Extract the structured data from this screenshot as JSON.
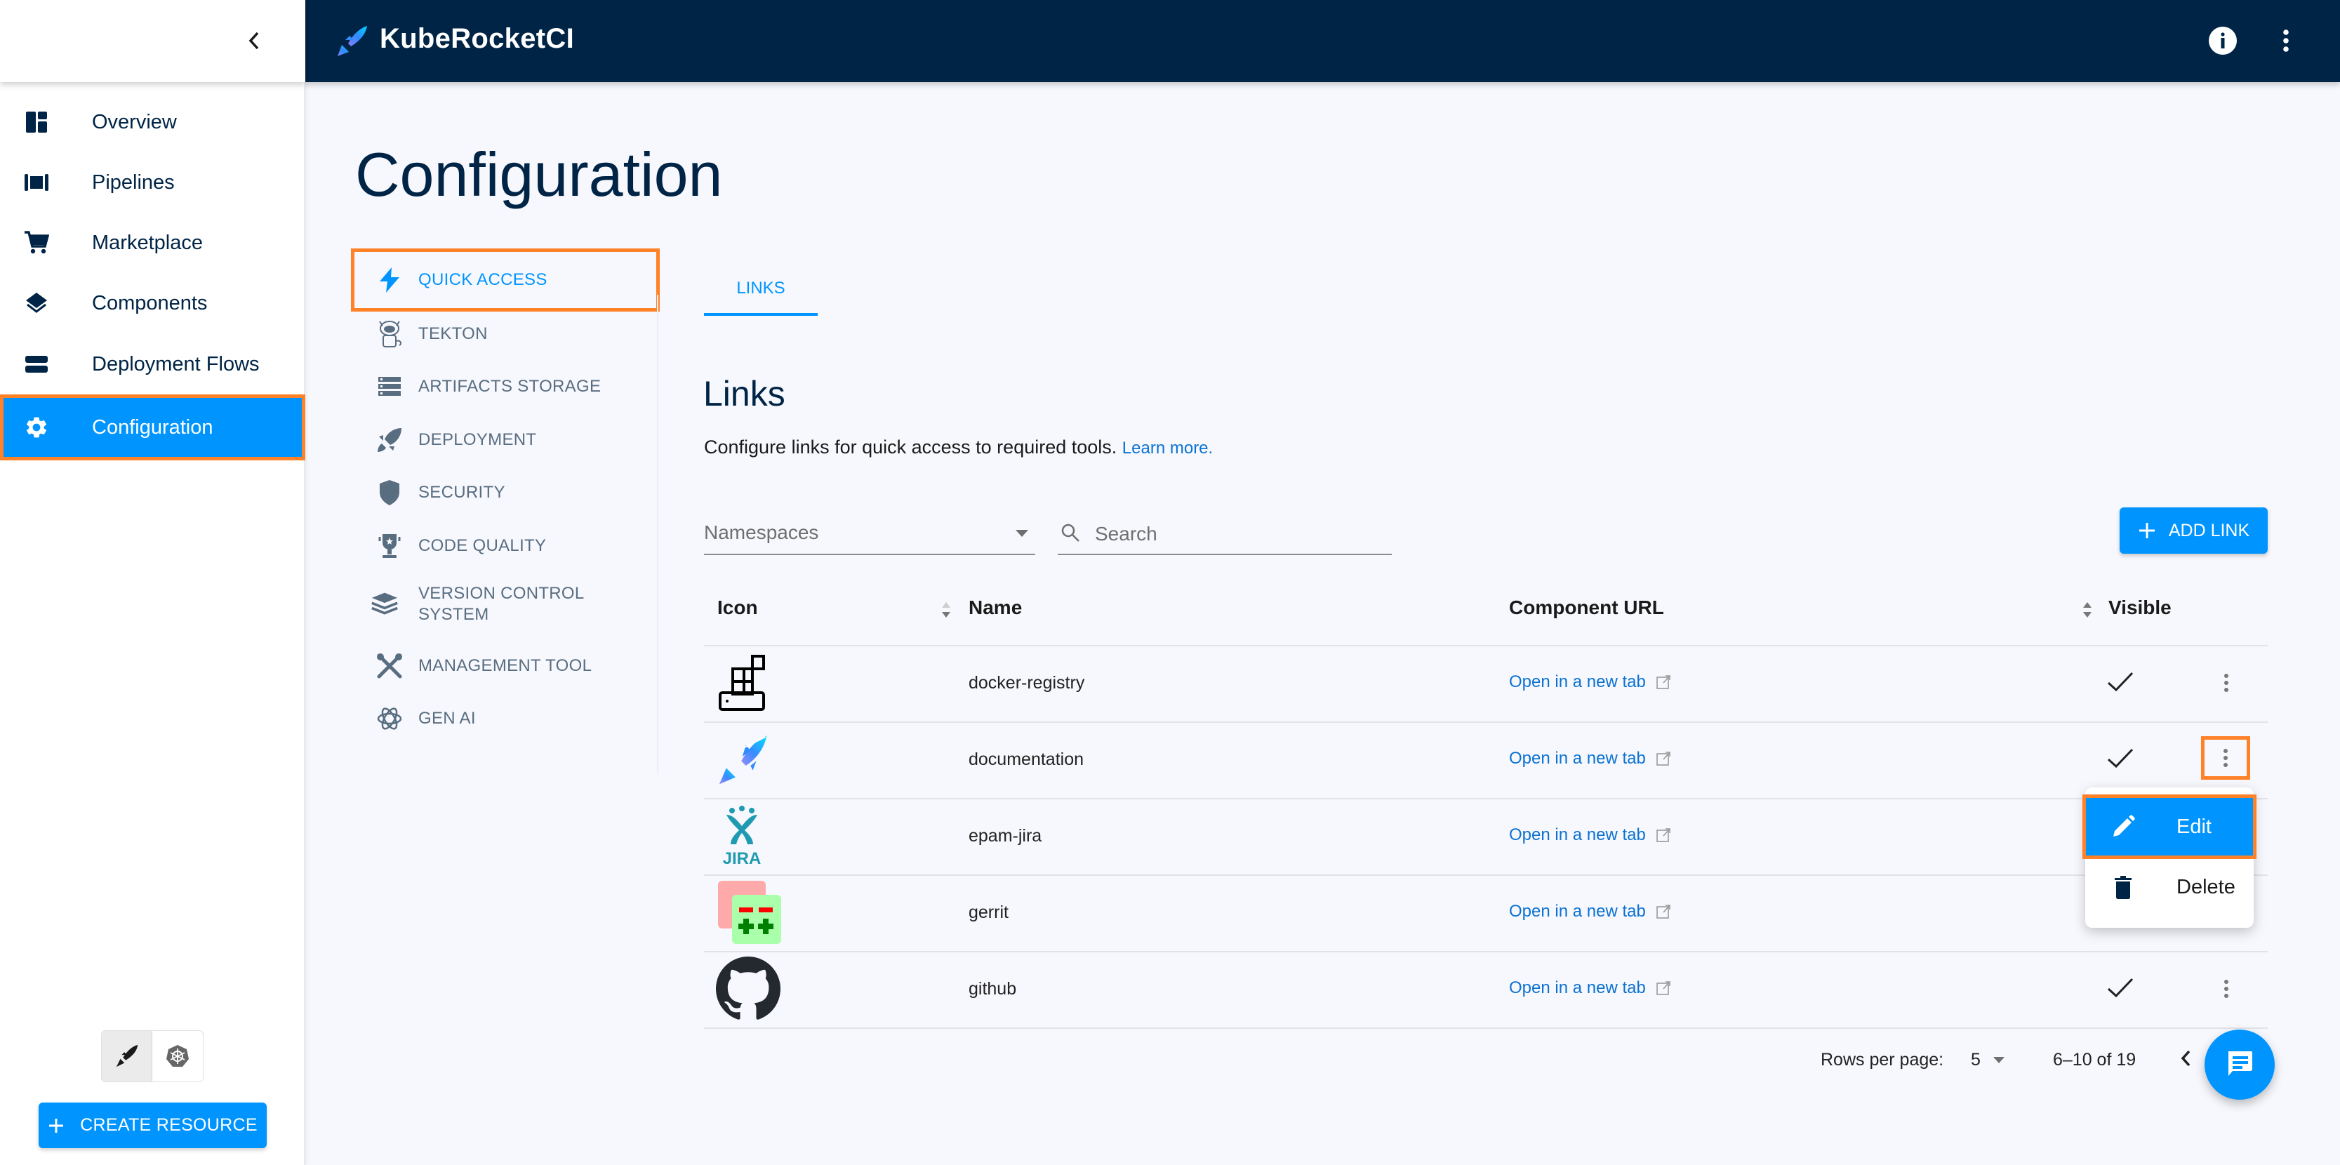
{
  "app": {
    "title": "KubeRocketCI",
    "brand_color": "#002446",
    "accent_color": "#0094ff",
    "highlight_color": "#ff8128"
  },
  "sidebar": {
    "items": [
      {
        "label": "Overview",
        "icon": "dashboard-icon"
      },
      {
        "label": "Pipelines",
        "icon": "pipelines-icon"
      },
      {
        "label": "Marketplace",
        "icon": "cart-icon"
      },
      {
        "label": "Components",
        "icon": "layers-icon"
      },
      {
        "label": "Deployment Flows",
        "icon": "flows-icon"
      },
      {
        "label": "Configuration",
        "icon": "gear-icon",
        "active": true
      }
    ],
    "mode_toggle": [
      "krci-mode",
      "kubernetes-mode"
    ],
    "create_button": "CREATE RESOURCE"
  },
  "page": {
    "title": "Configuration"
  },
  "subnav": {
    "items": [
      {
        "label": "QUICK ACCESS",
        "icon": "bolt-icon",
        "active": true
      },
      {
        "label": "TEKTON",
        "icon": "tekton-icon"
      },
      {
        "label": "ARTIFACTS STORAGE",
        "icon": "storage-icon"
      },
      {
        "label": "DEPLOYMENT",
        "icon": "rocket-icon"
      },
      {
        "label": "SECURITY",
        "icon": "shield-icon"
      },
      {
        "label": "CODE QUALITY",
        "icon": "trophy-icon"
      },
      {
        "label": "VERSION CONTROL SYSTEM",
        "icon": "stack-icon"
      },
      {
        "label": "MANAGEMENT TOOL",
        "icon": "tools-icon"
      },
      {
        "label": "GEN AI",
        "icon": "genai-icon"
      }
    ]
  },
  "tabs": [
    {
      "label": "LINKS",
      "active": true
    }
  ],
  "links": {
    "heading": "Links",
    "description": "Configure links for quick access to required tools.",
    "learn_more": "Learn more.",
    "namespaces_label": "Namespaces",
    "search_placeholder": "Search",
    "add_button": "ADD LINK"
  },
  "table": {
    "columns": [
      "Icon",
      "Name",
      "Component URL",
      "Visible"
    ],
    "rows": [
      {
        "icon": "docker-registry-icon",
        "name": "docker-registry",
        "url_label": "Open in a new tab",
        "visible": true
      },
      {
        "icon": "krci-logo-icon",
        "name": "documentation",
        "url_label": "Open in a new tab",
        "visible": true
      },
      {
        "icon": "jira-icon",
        "name": "epam-jira",
        "url_label": "Open in a new tab",
        "visible": true
      },
      {
        "icon": "gerrit-icon",
        "name": "gerrit",
        "url_label": "Open in a new tab",
        "visible": true
      },
      {
        "icon": "github-icon",
        "name": "github",
        "url_label": "Open in a new tab",
        "visible": true
      }
    ]
  },
  "row_menu": {
    "items": [
      {
        "label": "Edit",
        "icon": "pencil-icon",
        "active": true
      },
      {
        "label": "Delete",
        "icon": "trash-icon"
      }
    ]
  },
  "pagination": {
    "rows_per_page_label": "Rows per page:",
    "rows_per_page": "5",
    "range": "6–10 of 19"
  }
}
